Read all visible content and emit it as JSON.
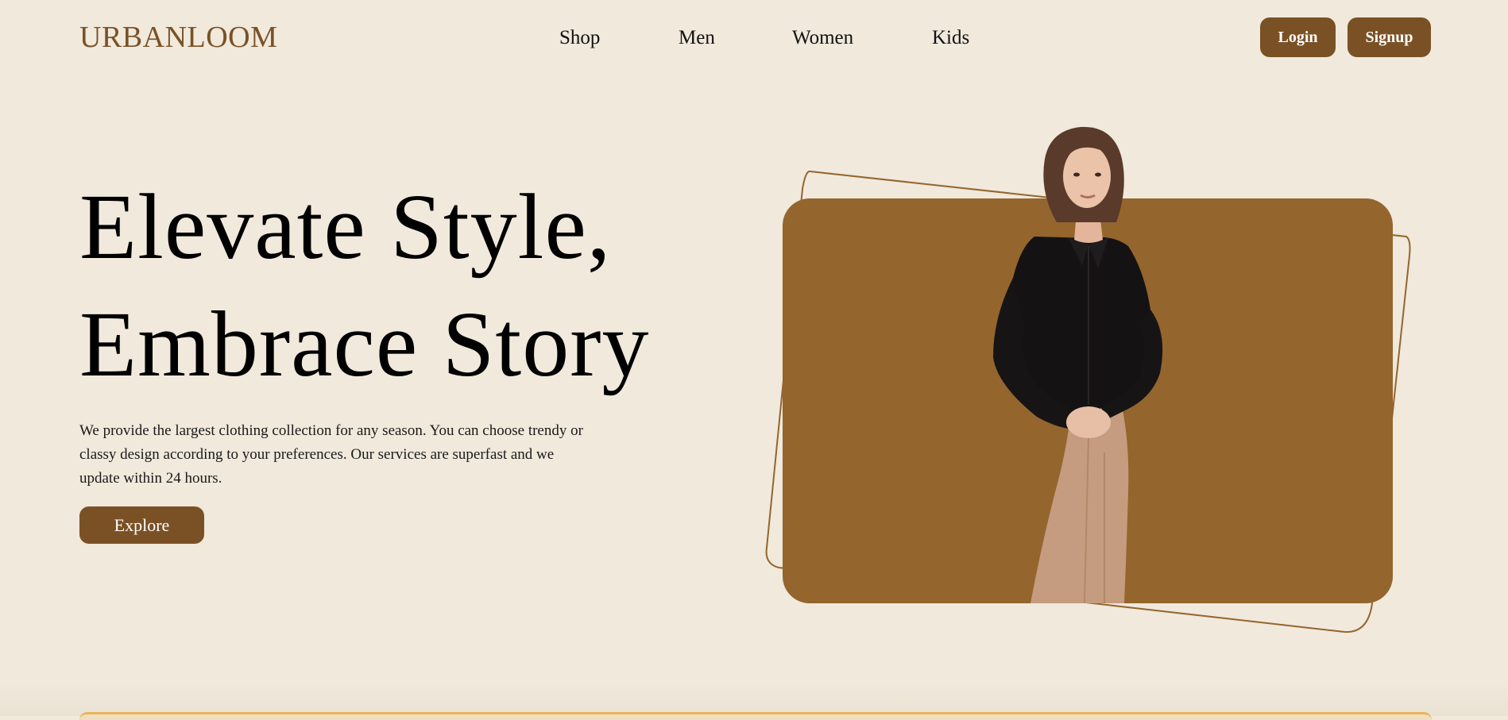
{
  "brand": {
    "logo_text": "URBANLOOM",
    "accent": "#7A5125",
    "card_color": "#94652D",
    "background": "#F0E9DC"
  },
  "nav": {
    "items": [
      {
        "label": "Shop"
      },
      {
        "label": "Men"
      },
      {
        "label": "Women"
      },
      {
        "label": "Kids"
      }
    ]
  },
  "auth": {
    "login_label": "Login",
    "signup_label": "Signup"
  },
  "hero": {
    "title_line1": "Elevate Style,",
    "title_line2": "Embrace Story",
    "description": "We provide the largest clothing collection for any season. You can choose trendy or classy design according to your preferences. Our services are superfast and we update within 24 hours.",
    "cta_label": "Explore"
  },
  "icons": {
    "hero_image": "model-photo"
  }
}
